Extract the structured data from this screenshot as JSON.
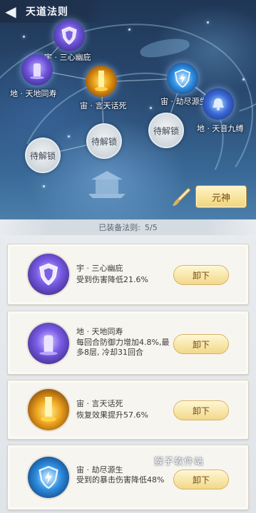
{
  "header": {
    "title": "天道法则"
  },
  "map_nodes": {
    "yu_sanxin": "宇 · 三心幽庇",
    "di_tiandi": "地 · 天地同寿",
    "zhou_yantian": "宙 · 言天话死",
    "zhou_jiejin": "宙 · 劫尽源生",
    "di_tianyin": "地 · 天音九缚"
  },
  "locked_slots": [
    "待解锁",
    "待解锁",
    "待解锁"
  ],
  "yuanshen_button": "元神",
  "equipped": {
    "label": "已装备法则:",
    "count": "5/5"
  },
  "cards": [
    {
      "name": "宇 · 三心幽庇",
      "desc": "受到伤害降低21.6%",
      "button": "卸下",
      "icon": "shield-purple-icon"
    },
    {
      "name": "地 · 天地同寿",
      "desc": "每回合防御力增加4.8%,最多8层, 冷却31回合",
      "button": "卸下",
      "icon": "pillar-purple-icon"
    },
    {
      "name": "宙 · 言天话死",
      "desc": "恢复效果提升57.6%",
      "button": "卸下",
      "icon": "light-pillar-gold-icon"
    },
    {
      "name": "宙 · 劫尽源生",
      "desc": "受到的暴击伤害降低48%",
      "button": "卸下",
      "icon": "shield-lightning-blue-icon"
    }
  ],
  "watermark": "猴子软件站",
  "colors": {
    "sky": "#2a4b72",
    "button_gold": "#f1d57a",
    "panel": "#e9ecef"
  }
}
